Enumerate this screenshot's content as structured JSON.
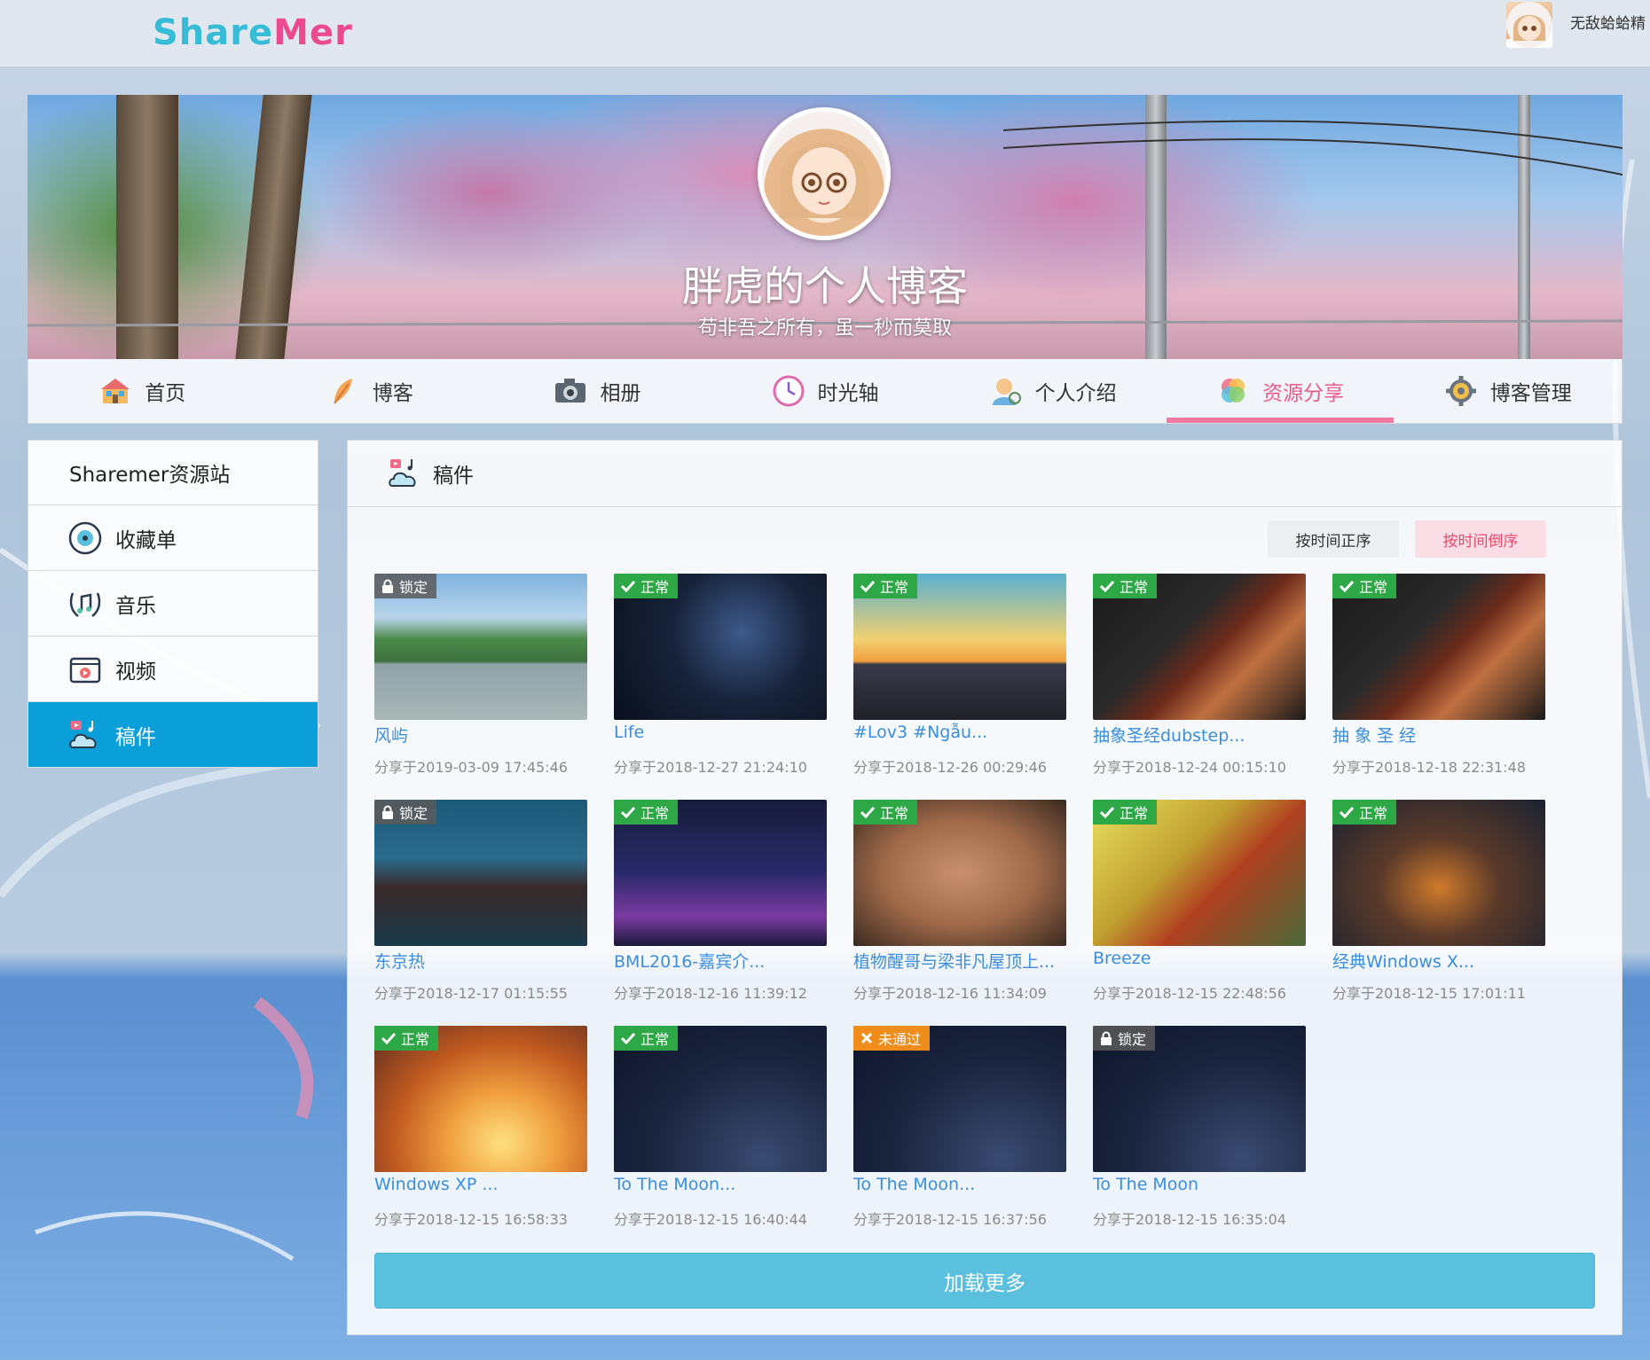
{
  "header": {
    "logo_part1": "Share",
    "logo_part2": "Mer",
    "user_name": "无敌蛤蛤精"
  },
  "banner": {
    "title": "胖虎的个人博客",
    "subtitle": "苟非吾之所有，虽一秒而莫取"
  },
  "nav": [
    {
      "label": "首页",
      "icon": "home-icon"
    },
    {
      "label": "博客",
      "icon": "feather-icon"
    },
    {
      "label": "相册",
      "icon": "camera-icon"
    },
    {
      "label": "时光轴",
      "icon": "clock-icon"
    },
    {
      "label": "个人介绍",
      "icon": "person-icon"
    },
    {
      "label": "资源分享",
      "icon": "share-icon",
      "active": true
    },
    {
      "label": "博客管理",
      "icon": "gear-icon"
    }
  ],
  "sidebar": {
    "title": "Sharemer资源站",
    "items": [
      {
        "label": "收藏单",
        "icon": "disc-icon"
      },
      {
        "label": "音乐",
        "icon": "music-icon"
      },
      {
        "label": "视频",
        "icon": "video-icon"
      },
      {
        "label": "稿件",
        "icon": "manuscript-icon",
        "active": true
      }
    ]
  },
  "main": {
    "title": "稿件",
    "sort_asc": "按时间正序",
    "sort_desc": "按时间倒序",
    "load_more": "加载更多",
    "cards": [
      {
        "status": "锁定",
        "type": "lock",
        "title": "风屿",
        "time": "分享于2019-03-09 17:45:46",
        "art": "t-landscape"
      },
      {
        "status": "正常",
        "type": "ok",
        "title": "Life",
        "time": "分享于2018-12-27 21:24:10",
        "art": "t-space"
      },
      {
        "status": "正常",
        "type": "ok",
        "title": "#Lov3 #Ngẫu...",
        "time": "分享于2018-12-26 00:29:46",
        "art": "t-city"
      },
      {
        "status": "正常",
        "type": "ok",
        "title": "抽象圣经dubstep...",
        "time": "分享于2018-12-24 00:15:10",
        "art": "t-stream"
      },
      {
        "status": "正常",
        "type": "ok",
        "title": "抽 象 圣 经",
        "time": "分享于2018-12-18 22:31:48",
        "art": "t-stream"
      },
      {
        "status": "锁定",
        "type": "lock",
        "title": "东京热",
        "time": "分享于2018-12-17 01:15:55",
        "art": "t-forest"
      },
      {
        "status": "正常",
        "type": "ok",
        "title": "BML2016-嘉宾介...",
        "time": "分享于2018-12-16 11:39:12",
        "art": "t-bili"
      },
      {
        "status": "正常",
        "type": "ok",
        "title": "植物醒哥与梁非凡屋顶上...",
        "time": "分享于2018-12-16 11:34:09",
        "art": "t-face"
      },
      {
        "status": "正常",
        "type": "ok",
        "title": "Breeze",
        "time": "分享于2018-12-15 22:48:56",
        "art": "t-autumn"
      },
      {
        "status": "正常",
        "type": "ok",
        "title": "经典Windows X...",
        "time": "分享于2018-12-15 17:01:11",
        "art": "t-night-town"
      },
      {
        "status": "正常",
        "type": "ok",
        "title": "Windows XP ...",
        "time": "分享于2018-12-15 16:58:33",
        "art": "t-sunset"
      },
      {
        "status": "正常",
        "type": "ok",
        "title": "To The Moon...",
        "time": "分享于2018-12-15 16:40:44",
        "art": "t-moon"
      },
      {
        "status": "未通过",
        "type": "fail",
        "title": "To The Moon...",
        "time": "分享于2018-12-15 16:37:56",
        "art": "t-moon"
      },
      {
        "status": "锁定",
        "type": "lock",
        "title": "To The Moon",
        "time": "分享于2018-12-15 16:35:04",
        "art": "t-moon"
      }
    ]
  },
  "colors": {
    "accent_pink": "#ec5b8b",
    "sidebar_active": "#0a9fd8",
    "load_more": "#5bc0de",
    "badge_ok": "#2ea846",
    "badge_fail": "#f08c1a",
    "link": "#3c8ddc"
  }
}
